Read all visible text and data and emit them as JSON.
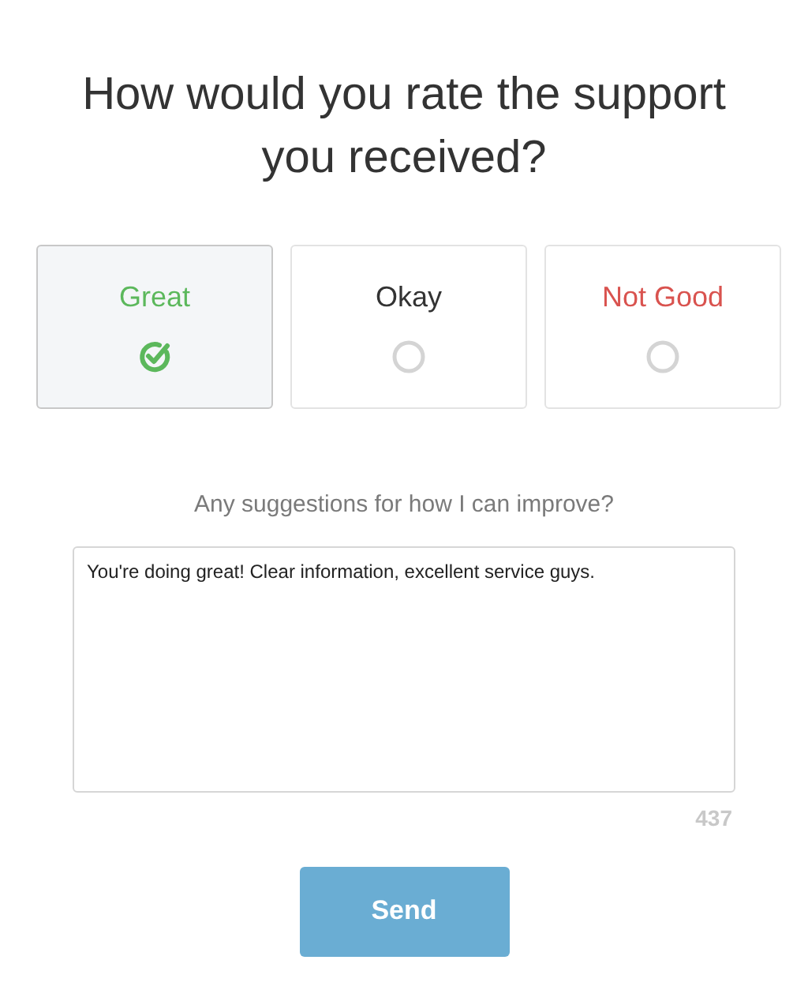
{
  "title": "How would you rate the support you received?",
  "options": [
    {
      "label": "Great",
      "color": "#5cb85c",
      "selected": true
    },
    {
      "label": "Okay",
      "color": "#333333",
      "selected": false
    },
    {
      "label": "Not Good",
      "color": "#d9534f",
      "selected": false
    }
  ],
  "suggestions": {
    "label": "Any suggestions for how I can improve?",
    "value": "You're doing great! Clear information, excellent service guys.",
    "counter": "437"
  },
  "buttons": [
    {
      "label": "Send"
    }
  ]
}
